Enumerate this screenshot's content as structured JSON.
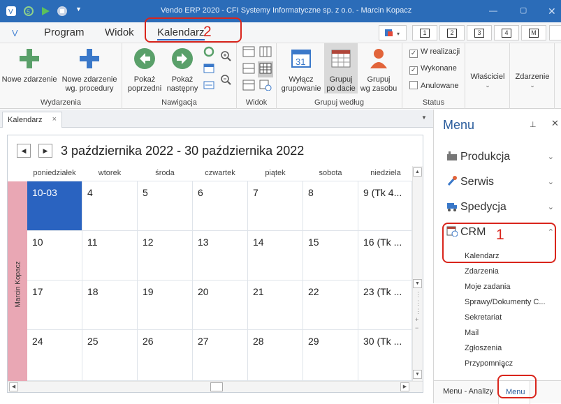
{
  "window": {
    "title": "Vendo ERP 2020 - CFI Systemy Informatyczne sp. z o.o. - Marcin Kopacz"
  },
  "menu": {
    "program": "Program",
    "widok": "Widok",
    "kalendarz": "Kalendarz"
  },
  "toolbar_right": {
    "b1": "1",
    "b2": "2",
    "b3": "3",
    "b4": "4",
    "b5": "M"
  },
  "ribbon": {
    "wydarzenia": {
      "label": "Wydarzenia",
      "nowe": "Nowe zdarzenie",
      "nowe_proc_1": "Nowe zdarzenie",
      "nowe_proc_2": "wg. procedury"
    },
    "nawigacja": {
      "label": "Nawigacja",
      "prev_1": "Pokaż",
      "prev_2": "poprzedni",
      "next_1": "Pokaż",
      "next_2": "następny"
    },
    "widok": {
      "label": "Widok"
    },
    "grupuj": {
      "label": "Grupuj według",
      "wylacz_1": "Wyłącz",
      "wylacz_2": "grupowanie",
      "data_1": "Grupuj",
      "data_2": "po dacie",
      "zasob_1": "Grupuj",
      "zasob_2": "wg zasobu"
    },
    "status": {
      "label": "Status",
      "w_realizacji": "W realizacji",
      "wykonane": "Wykonane",
      "anulowane": "Anulowane"
    },
    "wlasciciel": "Właściciel",
    "zdarzenie": "Zdarzenie"
  },
  "annotations": {
    "n1": "1",
    "n2": "2"
  },
  "document_tab": {
    "label": "Kalendarz",
    "close": "×"
  },
  "calendar": {
    "range": "3 października 2022 - 30 października 2022",
    "resource": "Marcin Kopacz",
    "days": [
      "poniedziałek",
      "wtorek",
      "środa",
      "czwartek",
      "piątek",
      "sobota",
      "niedziela"
    ],
    "weeks": [
      [
        "10-03",
        "4",
        "5",
        "6",
        "7",
        "8",
        "9 (Tk 4..."
      ],
      [
        "10",
        "11",
        "12",
        "13",
        "14",
        "15",
        "16 (Tk ..."
      ],
      [
        "17",
        "18",
        "19",
        "20",
        "21",
        "22",
        "23 (Tk ..."
      ],
      [
        "24",
        "25",
        "26",
        "27",
        "28",
        "29",
        "30 (Tk ..."
      ]
    ]
  },
  "sidebar": {
    "title": "Menu",
    "items": [
      {
        "label": "Produkcja"
      },
      {
        "label": "Serwis"
      },
      {
        "label": "Spedycja"
      },
      {
        "label": "CRM"
      }
    ],
    "crm_sub": [
      "Kalendarz",
      "Zdarzenia",
      "Moje zadania",
      "Sprawy/Dokumenty C...",
      "Sekretariat",
      "Mail",
      "Zgłoszenia",
      "Przypomniacz"
    ],
    "bottom_tabs": [
      "Menu - Analizy",
      "Menu"
    ]
  },
  "colors": {
    "titlebar": "#2b6cb8",
    "today": "#2a63c0",
    "annotation": "#d9251c",
    "resource": "#e9a7b4"
  }
}
